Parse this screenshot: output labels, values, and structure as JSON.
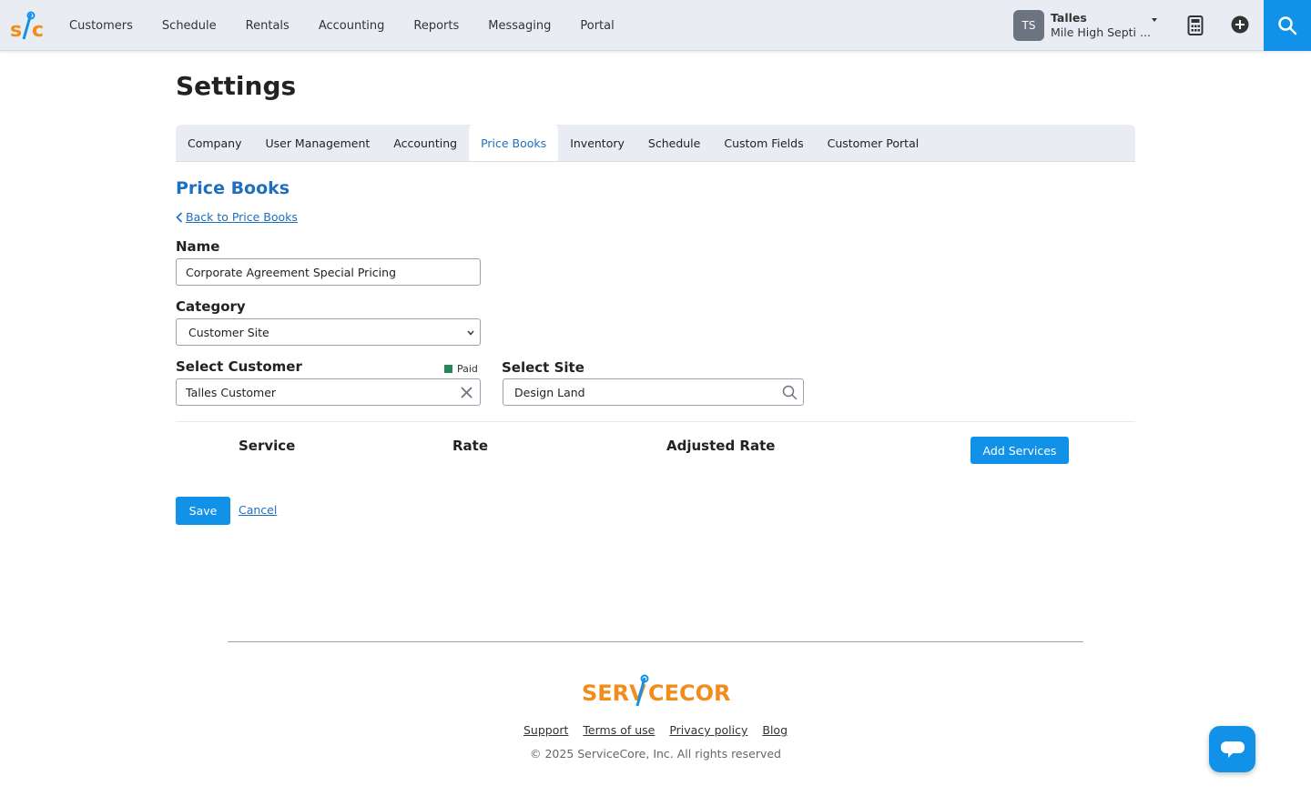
{
  "header": {
    "logo_text": "s/c",
    "nav": [
      "Customers",
      "Schedule",
      "Rentals",
      "Accounting",
      "Reports",
      "Messaging",
      "Portal"
    ],
    "user": {
      "initials": "TS",
      "name": "Talles",
      "company": "Mile High Septi ..."
    },
    "icons": [
      "calculator-icon",
      "plus-circle-icon",
      "search-icon"
    ],
    "accent_color": "#1192e8"
  },
  "page": {
    "title": "Settings",
    "tabs": [
      "Company",
      "User Management",
      "Accounting",
      "Price Books",
      "Inventory",
      "Schedule",
      "Custom Fields",
      "Customer Portal"
    ],
    "active_tab": "Price Books"
  },
  "form": {
    "section_title": "Price Books",
    "back_link": "Back to Price Books",
    "name_label": "Name",
    "name_value": "Corporate Agreement Special Pricing",
    "category_label": "Category",
    "category_value": "Customer Site",
    "customer_label": "Select Customer",
    "customer_status": "Paid",
    "customer_status_color": "#23875a",
    "customer_value": "Talles Customer",
    "site_label": "Select Site",
    "site_value": "Design Land"
  },
  "services_table": {
    "headers": [
      "Service",
      "Rate",
      "Adjusted Rate"
    ],
    "add_button": "Add Services",
    "rows": []
  },
  "actions": {
    "save": "Save",
    "cancel": "Cancel"
  },
  "footer": {
    "logo_text": "ServiceCore",
    "links": [
      "Support",
      "Terms of use",
      "Privacy policy",
      "Blog"
    ],
    "copyright": "© 2025 ServiceCore, Inc. All rights reserved"
  }
}
